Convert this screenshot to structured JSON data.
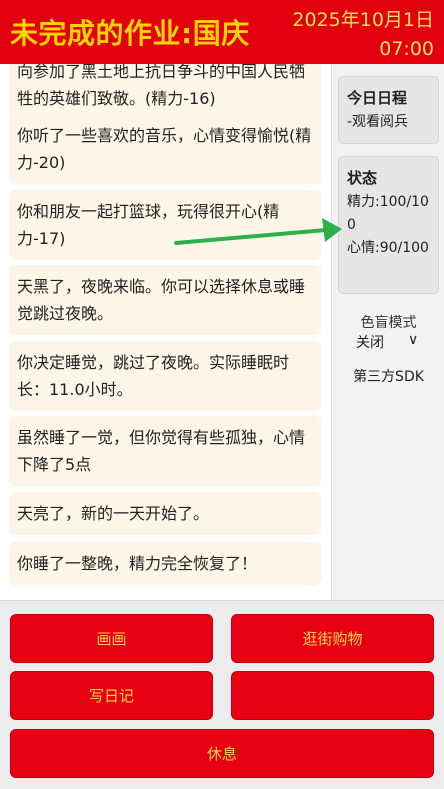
{
  "header": {
    "title": "未完成的作业:国庆",
    "date": "2025年10月1日",
    "time": "07:00"
  },
  "feed": {
    "messages": [
      "向参加了黑土地上抗日争斗的中国人民牺牲的英雄们致敬。(精力-16)",
      "你听了一些喜欢的音乐，心情变得愉悦(精力-20)",
      "你和朋友一起打篮球，玩得很开心(精力-17)",
      "天黑了，夜晚来临。你可以选择休息或睡觉跳过夜晚。",
      "你决定睡觉，跳过了夜晚。实际睡眠时长：11.0小时。",
      "虽然睡了一觉，但你觉得有些孤独，心情下降了5点",
      "天亮了，新的一天开始了。",
      "你睡了一整晚，精力完全恢复了！"
    ]
  },
  "sidebar": {
    "schedule": {
      "title": "今日日程",
      "item": "-观看阅兵"
    },
    "status": {
      "title": "状态",
      "energy": "精力:100/100",
      "mood": "心情:90/100"
    },
    "colorblind": {
      "label": "色盲模式",
      "value": "关闭",
      "chevron": "∨"
    },
    "sdk": "第三方SDK"
  },
  "actions": {
    "draw": "画画",
    "shopping": "逛街购物",
    "diary": "写日记",
    "unknown": "",
    "rest": "休息"
  },
  "colors": {
    "header_bg": "#e2000f",
    "title_yellow": "#ffd400",
    "button_red": "#e60012",
    "arrow_green": "#2bb04a"
  }
}
